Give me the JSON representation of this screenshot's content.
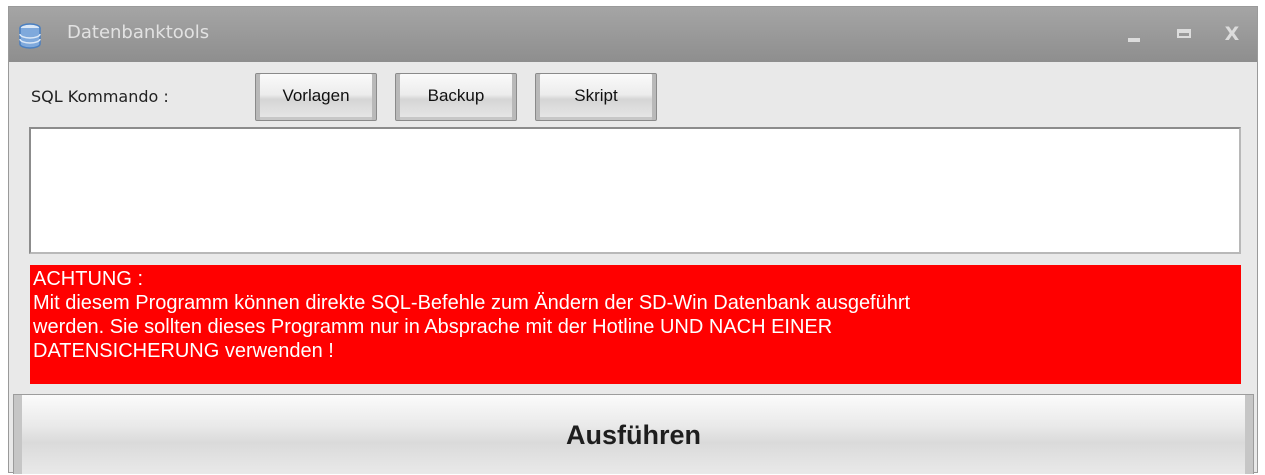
{
  "window": {
    "title": "Datenbanktools",
    "icon": "database-icon",
    "controls": {
      "minimize": "minimize-icon",
      "maximize": "maximize-icon",
      "close_label": "X"
    }
  },
  "toolbar": {
    "sql_label": "SQL Kommando :",
    "buttons": {
      "vorlagen": "Vorlagen",
      "backup": "Backup",
      "skript": "Skript"
    }
  },
  "sql_input": {
    "value": ""
  },
  "warning": {
    "lines": [
      "ACHTUNG :",
      "Mit diesem Programm können direkte SQL-Befehle zum Ändern der SD-Win Datenbank ausgeführt",
      "werden. Sie sollten dieses Programm nur in Absprache mit der Hotline UND NACH EINER",
      "DATENSICHERUNG verwenden !"
    ],
    "color": "#ff0000"
  },
  "actions": {
    "run_label": "Ausführen"
  }
}
